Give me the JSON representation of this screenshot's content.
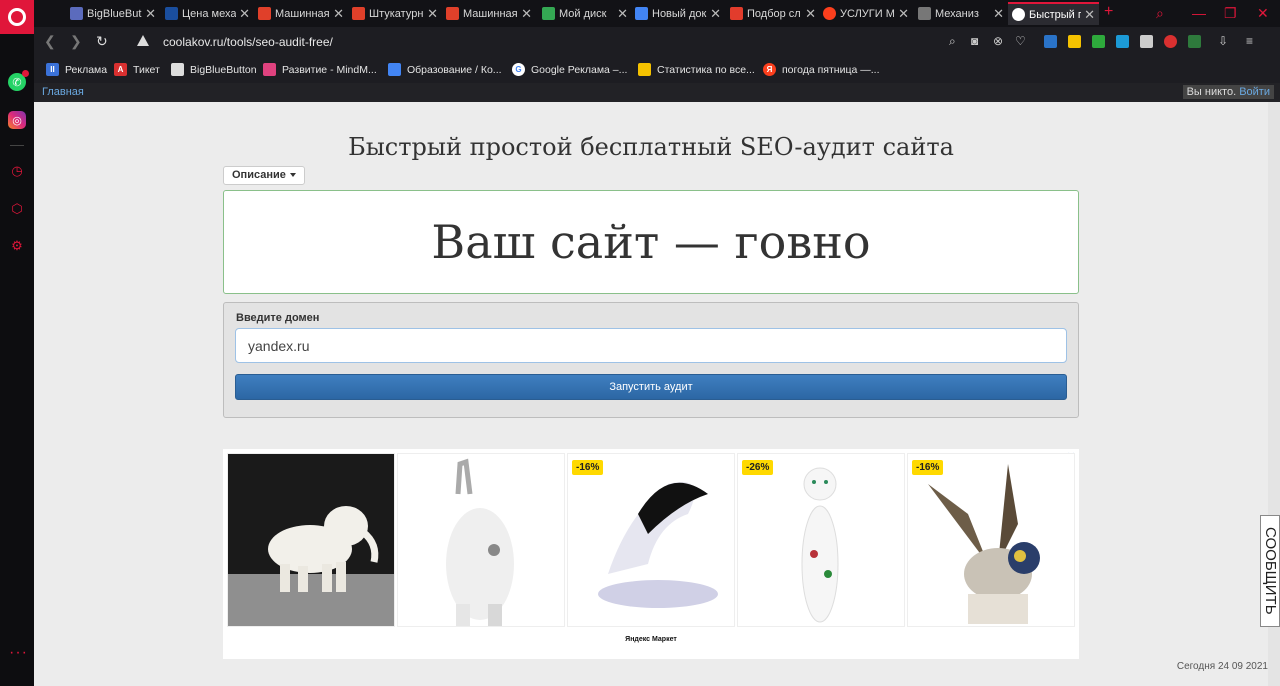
{
  "browser": {
    "tabs": [
      {
        "title": "BigBlueBut",
        "color": "#5b6bbd"
      },
      {
        "title": "Цена меха",
        "color": "#1a4e9e"
      },
      {
        "title": "Машинная",
        "color": "#e0402a"
      },
      {
        "title": "Штукатурн",
        "color": "#e0402a"
      },
      {
        "title": "Машинная",
        "color": "#e0402a"
      },
      {
        "title": "Мой диск",
        "color": "#34a853"
      },
      {
        "title": "Новый док",
        "color": "#4285f4"
      },
      {
        "title": "Подбор сл",
        "color": "#e23c2c"
      },
      {
        "title": "УСЛУГИ М",
        "color": "#fc3f1d"
      },
      {
        "title": "Механиз",
        "color": "#777777"
      }
    ],
    "active_tab": {
      "title": "Быстрый п"
    },
    "url": "coolakov.ru/tools/seo-audit-free/",
    "bookmarks": [
      {
        "label": "Реклама",
        "icon": "II",
        "color": "#3b72d9"
      },
      {
        "label": "Тикет",
        "icon": "A",
        "color": "#d93030"
      },
      {
        "label": "BigBlueButton",
        "icon": "",
        "color": "#dddddd"
      },
      {
        "label": "Развитие - MindM...",
        "icon": "",
        "color": "#e0427f"
      },
      {
        "label": "Образование / Ко...",
        "icon": "",
        "color": "#4285f4"
      },
      {
        "label": "Google Реклама –...",
        "icon": "G",
        "color": "#ffffff"
      },
      {
        "label": "Статистика по все...",
        "icon": "",
        "color": "#f5c200"
      },
      {
        "label": "погода пятница —...",
        "icon": "Я",
        "color": "#fc3f1d"
      }
    ]
  },
  "page": {
    "nav_home": "Главная",
    "user_text": "Вы никто.",
    "login_link": "Войти",
    "heading": "Быстрый простой бесплатный SEO-аудит сайта",
    "description_button": "Описание",
    "verdict": "Ваш сайт — говно",
    "form": {
      "label": "Введите домен",
      "domain_value": "yandex.ru",
      "submit_label": "Запустить аудит"
    },
    "ad": {
      "discounts": [
        "-16%",
        "-26%",
        "-16%"
      ],
      "footer": "Яндекс Маркет"
    },
    "date_text": "Сегодня 24 09 2021",
    "feedback_label": "СООБЩИТЬ"
  }
}
